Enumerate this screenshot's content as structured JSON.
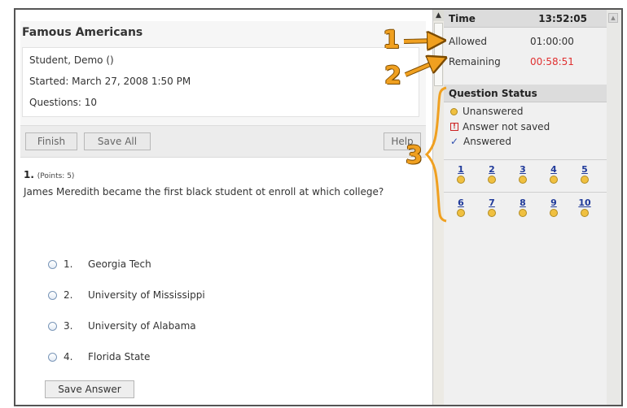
{
  "quiz": {
    "title": "Famous Americans",
    "student": "Student, Demo ()",
    "started": "Started: March 27, 2008 1:50 PM",
    "questions": "Questions: 10"
  },
  "toolbar": {
    "finish_label": "Finish",
    "save_all_label": "Save All",
    "help_label": "Help"
  },
  "question": {
    "number": "1.",
    "points": "(Points: 5)",
    "text": "James Meredith became the first black student ot enroll at which college?",
    "options": [
      {
        "num": "1.",
        "label": "Georgia Tech"
      },
      {
        "num": "2.",
        "label": "University of Mississippi"
      },
      {
        "num": "3.",
        "label": "University of Alabama"
      },
      {
        "num": "4.",
        "label": "Florida State"
      }
    ],
    "save_answer_label": "Save Answer"
  },
  "timer": {
    "header_label": "Time",
    "clock": "13:52:05",
    "allowed_label": "Allowed",
    "allowed_value": "01:00:00",
    "remaining_label": "Remaining",
    "remaining_value": "00:58:51"
  },
  "status": {
    "header": "Question Status",
    "legend": {
      "unanswered": "Unanswered",
      "not_saved": "Answer not saved",
      "answered": "Answered"
    },
    "question_links": [
      "1",
      "2",
      "3",
      "4",
      "5",
      "6",
      "7",
      "8",
      "9",
      "10"
    ]
  },
  "annotations": {
    "callout_1": "1",
    "callout_2": "2",
    "callout_3": "3"
  },
  "colors": {
    "accent_orange": "#f0a020",
    "remaining_red": "#e03030",
    "unanswered_dot": "#f0c040",
    "link_blue": "#203a9a"
  }
}
